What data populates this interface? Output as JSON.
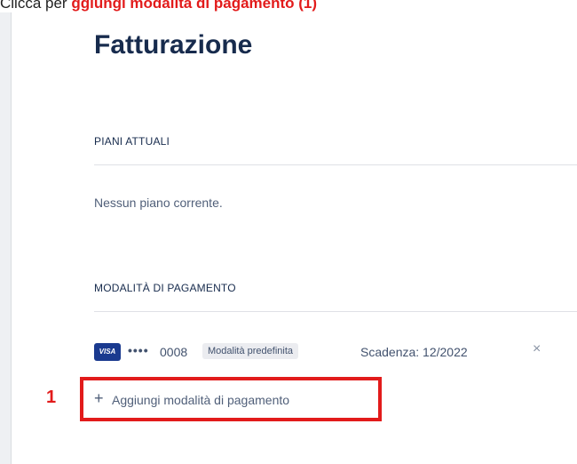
{
  "instruction": {
    "prefix": "Clicca per",
    "highlight": "ggiungi modalità di pagamento (1)"
  },
  "page": {
    "title": "Fatturazione"
  },
  "plans": {
    "heading": "PIANI ATTUALI",
    "empty_text": "Nessun piano corrente."
  },
  "payment": {
    "heading": "MODALITÀ DI PAGAMENTO",
    "card": {
      "brand": "VISA",
      "masked": "••••",
      "last4": "0008",
      "badge": "Modalità predefinita",
      "expiry": "Scadenza: 12/2022",
      "remove_glyph": "×"
    },
    "add_button": {
      "plus": "+",
      "label": "Aggiungi modalità di pagamento"
    }
  },
  "annotation": {
    "step_number": "1",
    "color": "#e21b1b"
  },
  "colors": {
    "title": "#172b4d",
    "text_muted": "#505f79",
    "visa_blue": "#1a3a8f",
    "highlight_red": "#e21b1b"
  }
}
